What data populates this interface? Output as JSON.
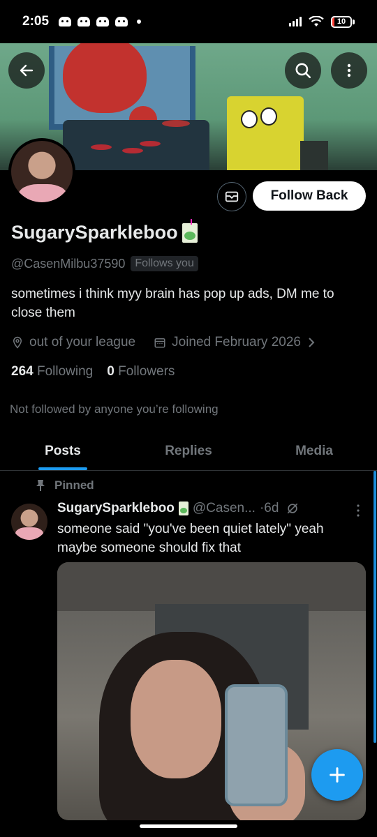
{
  "status_bar": {
    "time": "2:05",
    "battery": "10",
    "battery_level": 0.1,
    "notification_icons": [
      "discord-icon",
      "discord-icon",
      "discord-icon",
      "discord-icon"
    ]
  },
  "profile": {
    "display_name": "SugarySparkleboo",
    "name_emoji": "juice-box-icon",
    "handle": "@CasenMilbu37590",
    "follows_you": "Follows you",
    "bio": "sometimes i think myy brain has pop up ads, DM me to close them",
    "location": "out of your league",
    "joined": "Joined February 2026",
    "following_count": "264",
    "following_label": "Following",
    "followers_count": "0",
    "followers_label": "Followers",
    "not_followed": "Not followed by anyone you’re following",
    "follow_button": "Follow Back"
  },
  "tabs": [
    {
      "label": "Posts",
      "active": true
    },
    {
      "label": "Replies",
      "active": false
    },
    {
      "label": "Media",
      "active": false
    }
  ],
  "post": {
    "pinned_label": "Pinned",
    "author": "SugarySparkleboo",
    "handle": "@Casen...",
    "time": "·6d",
    "text": "someone said \"you've been quiet lately\" yeah maybe someone should fix that"
  },
  "colors": {
    "accent": "#1d9bf0",
    "background": "#000000",
    "muted_text": "#71767b"
  }
}
